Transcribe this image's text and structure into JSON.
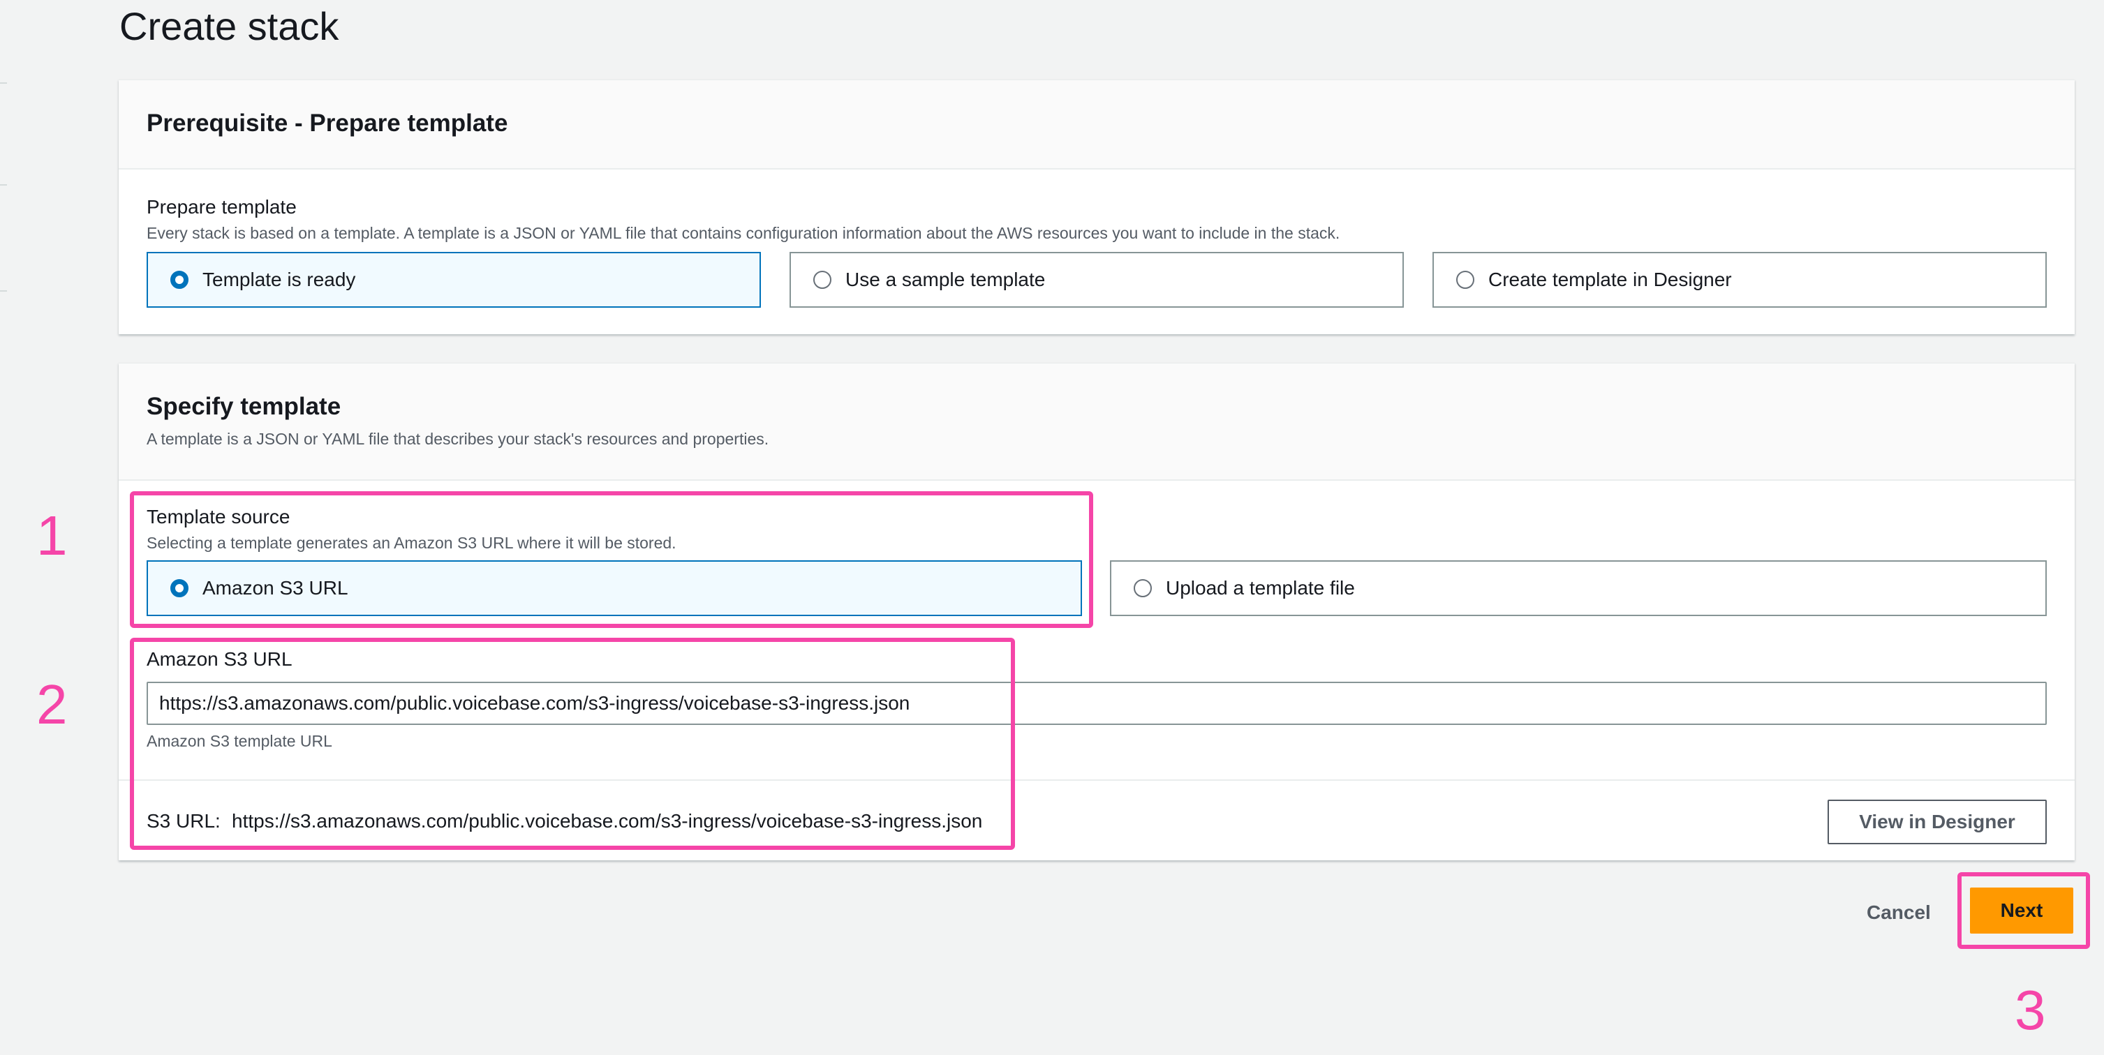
{
  "page": {
    "title": "Create stack"
  },
  "prerequisite": {
    "title": "Prerequisite - Prepare template",
    "field_label": "Prepare template",
    "field_desc": "Every stack is based on a template. A template is a JSON or YAML file that contains configuration information about the AWS resources you want to include in the stack.",
    "options": [
      {
        "label": "Template is ready",
        "selected": true
      },
      {
        "label": "Use a sample template",
        "selected": false
      },
      {
        "label": "Create template in Designer",
        "selected": false
      }
    ]
  },
  "specify": {
    "title": "Specify template",
    "desc": "A template is a JSON or YAML file that describes your stack's resources and properties.",
    "source_label": "Template source",
    "source_desc": "Selecting a template generates an Amazon S3 URL where it will be stored.",
    "source_options": [
      {
        "label": "Amazon S3 URL",
        "selected": true
      },
      {
        "label": "Upload a template file",
        "selected": false
      }
    ],
    "url_label": "Amazon S3 URL",
    "url_value": "https://s3.amazonaws.com/public.voicebase.com/s3-ingress/voicebase-s3-ingress.json",
    "url_hint": "Amazon S3 template URL",
    "s3_prefix": "S3 URL:",
    "s3_value": "https://s3.amazonaws.com/public.voicebase.com/s3-ingress/voicebase-s3-ingress.json",
    "view_designer_label": "View in Designer"
  },
  "actions": {
    "cancel_label": "Cancel",
    "next_label": "Next"
  },
  "annotations": {
    "step1": "1",
    "step2": "2",
    "step3": "3"
  },
  "colors": {
    "accent": "#0073bb",
    "primary_button": "#ff9900",
    "annotation": "#f545a8"
  }
}
